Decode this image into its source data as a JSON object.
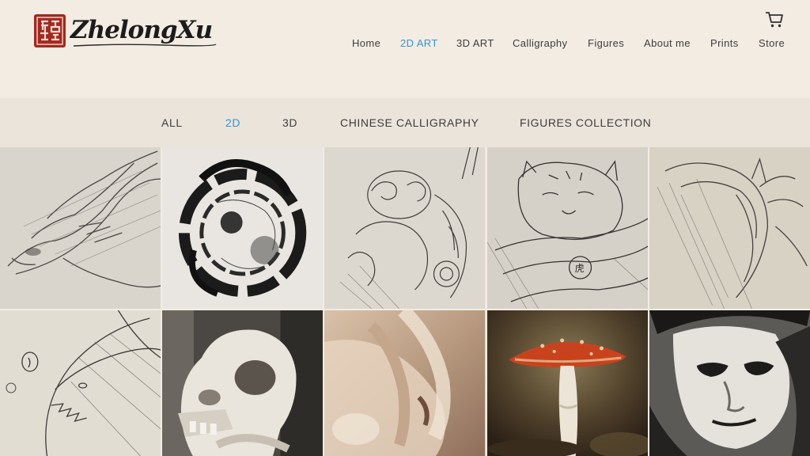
{
  "header": {
    "brand_mark": "ZhelongXu",
    "brand_mark_image": "brand-wordmark-with-red-seal",
    "cart_icon": "shopping-cart-icon",
    "nav": [
      {
        "label": "Home",
        "active": false
      },
      {
        "label": "2D ART",
        "active": true
      },
      {
        "label": "3D ART",
        "active": false
      },
      {
        "label": "Calligraphy",
        "active": false
      },
      {
        "label": "Figures",
        "active": false
      },
      {
        "label": "About me",
        "active": false
      },
      {
        "label": "Prints",
        "active": false
      },
      {
        "label": "Store",
        "active": false
      }
    ]
  },
  "filters": [
    {
      "label": "ALL",
      "active": false
    },
    {
      "label": "2D",
      "active": true
    },
    {
      "label": "3D",
      "active": false
    },
    {
      "label": "CHINESE CALLIGRAPHY",
      "active": false
    },
    {
      "label": "FIGURES COLLECTION",
      "active": false
    }
  ],
  "colors": {
    "accent": "#2f96d8",
    "background": "#f3ece3",
    "filter_bar": "#ebe4db",
    "seal_red": "#a5271d"
  },
  "gallery": [
    {
      "thumbnail": "pencil-sketch-dragon-head"
    },
    {
      "thumbnail": "ink-coiled-dragon-circle"
    },
    {
      "thumbnail": "ornate-mech-creature-sketch"
    },
    {
      "thumbnail": "tiger-character-sketch"
    },
    {
      "thumbnail": "pencil-sketch-dragon-side"
    },
    {
      "thumbnail": "sea-creature-sketch"
    },
    {
      "thumbnail": "painted-animal-skull"
    },
    {
      "thumbnail": "painted-hand-closeup"
    },
    {
      "thumbnail": "painted-red-mushroom"
    },
    {
      "thumbnail": "painted-face-portrait"
    }
  ]
}
